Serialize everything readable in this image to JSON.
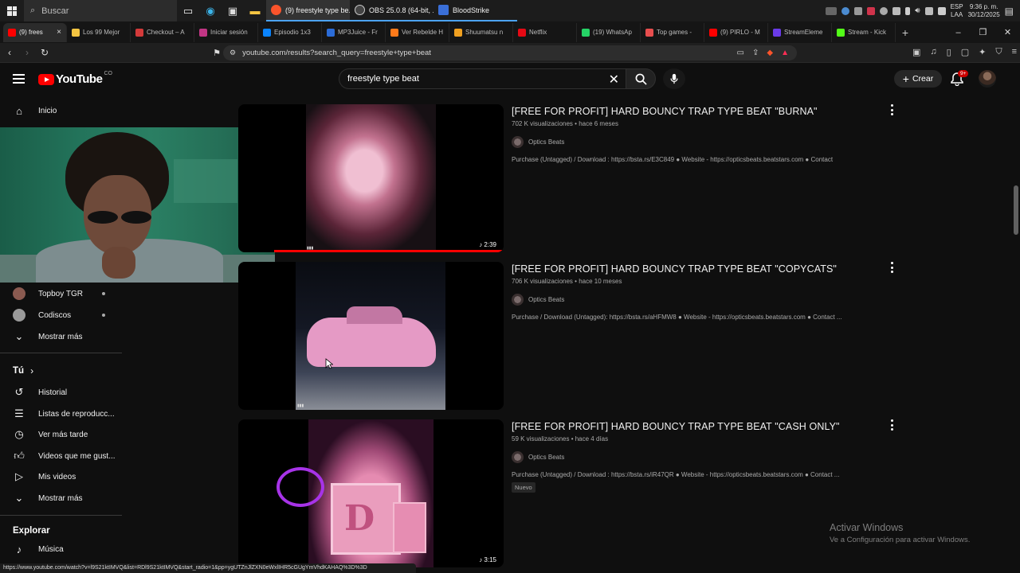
{
  "taskbar": {
    "search_placeholder": "Buscar",
    "apps": [
      {
        "label": "(9) freestyle type be...",
        "color": "#fb542b",
        "active": true
      },
      {
        "label": "OBS 25.0.8 (64-bit, ...",
        "color": "#444444",
        "active": false
      },
      {
        "label": "BloodStrike",
        "color": "#3a6fd8",
        "active": false
      }
    ],
    "tray": {
      "lang_top": "ESP",
      "lang_bottom": "LAA",
      "time": "9:36 p. m.",
      "date": "30/12/2025"
    }
  },
  "browser": {
    "tabs": [
      {
        "label": "(9) frees",
        "color": "#ff0000",
        "active": true
      },
      {
        "label": "Los 99 Mejor",
        "color": "#f4c542"
      },
      {
        "label": "Checkout – A",
        "color": "#d33a3a"
      },
      {
        "label": "Iniciar sesión",
        "color": "#c13584"
      },
      {
        "label": "Episodio 1x3",
        "color": "#0a84ff"
      },
      {
        "label": "MP3Juice - Fr",
        "color": "#2b6cd8"
      },
      {
        "label": "Ver Rebelde H",
        "color": "#ff7a1a"
      },
      {
        "label": "Shuumatsu n",
        "color": "#f0a020"
      },
      {
        "label": "Netflix",
        "color": "#e50914"
      },
      {
        "label": "(19) WhatsAp",
        "color": "#25d366"
      },
      {
        "label": "Top games -",
        "color": "#e84e4e"
      },
      {
        "label": "(9) PIRLO - M",
        "color": "#ff0000"
      },
      {
        "label": "StreamEleme",
        "color": "#6a3be8"
      },
      {
        "label": "Stream - Kick",
        "color": "#53fc18"
      }
    ],
    "new_tab": "+",
    "url": "youtube.com/results?search_query=freestyle+type+beat",
    "status_url": "https://www.youtube.com/watch?v=l9S21ktIMVQ&list=RDl9S21ktIMVQ&start_radio=1&pp=ygUTZnJlZXN0eWxlIHR5cGUgYmVhdKAHAQ%3D%3D"
  },
  "youtube": {
    "logo": "YouTube",
    "region": "CO",
    "search_value": "freestyle type beat",
    "create_label": "Crear",
    "notif_badge": "9+",
    "sidebar": {
      "home": "Inicio",
      "subscriptions": [
        {
          "name": "Topboy TGR",
          "color": "#8a5a50"
        },
        {
          "name": "Codiscos",
          "color": "#9a9a9a"
        }
      ],
      "show_more_1": "Mostrar más",
      "you_heading": "Tú",
      "you_items": [
        "Historial",
        "Listas de reproducc...",
        "Ver más tarde",
        "Videos que me gust...",
        "Mis videos"
      ],
      "show_more_2": "Mostrar más",
      "explore_heading": "Explorar",
      "music": "Música"
    },
    "results": [
      {
        "title": "[FREE FOR PROFIT] HARD BOUNCY TRAP TYPE BEAT \"BURNA\"",
        "views": "702 K visualizaciones",
        "age": "hace 6 meses",
        "channel": "Optics Beats",
        "description": "Purchase (Untagged) / Download : https://bsta.rs/E3C849 ● Website - https://opticsbeats.beatstars.com ● Contact",
        "duration": "2:39",
        "badge": ""
      },
      {
        "title": "[FREE FOR PROFIT] HARD BOUNCY TRAP TYPE BEAT \"COPYCATS\"",
        "views": "706 K visualizaciones",
        "age": "hace 10 meses",
        "channel": "Optics Beats",
        "description": "Purchase / Download (Untagged): https://bsta.rs/aHFMW8 ● Website - https://opticsbeats.beatstars.com ● Contact ...",
        "duration": "",
        "badge": ""
      },
      {
        "title": "[FREE FOR PROFIT] HARD BOUNCY TRAP TYPE BEAT \"CASH ONLY\"",
        "views": "59 K visualizaciones",
        "age": "hace 4 días",
        "channel": "Optics Beats",
        "description": "Purchase (Untagged) / Download : https://bsta.rs/iR47QR ● Website - https://opticsbeats.beatstars.com ● Contact ...",
        "duration": "3:15",
        "badge": "Nuevo"
      }
    ]
  },
  "windows_watermark": {
    "line1": "Activar Windows",
    "line2": "Ve a Configuración para activar Windows."
  }
}
